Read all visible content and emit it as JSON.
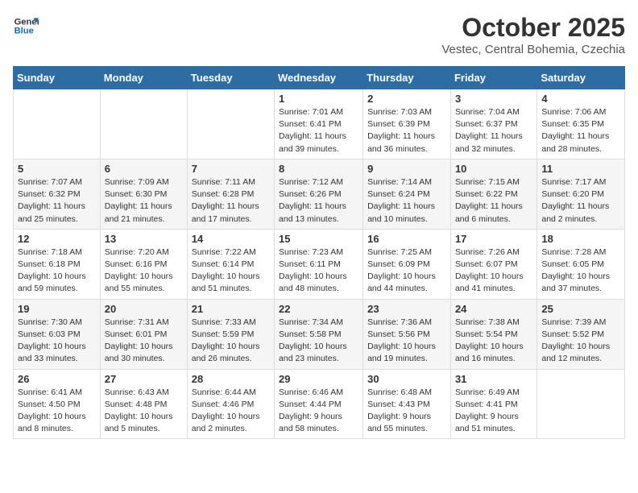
{
  "header": {
    "logo_line1": "General",
    "logo_line2": "Blue",
    "month": "October 2025",
    "location": "Vestec, Central Bohemia, Czechia"
  },
  "weekdays": [
    "Sunday",
    "Monday",
    "Tuesday",
    "Wednesday",
    "Thursday",
    "Friday",
    "Saturday"
  ],
  "weeks": [
    [
      {
        "day": "",
        "info": ""
      },
      {
        "day": "",
        "info": ""
      },
      {
        "day": "",
        "info": ""
      },
      {
        "day": "1",
        "info": "Sunrise: 7:01 AM\nSunset: 6:41 PM\nDaylight: 11 hours\nand 39 minutes."
      },
      {
        "day": "2",
        "info": "Sunrise: 7:03 AM\nSunset: 6:39 PM\nDaylight: 11 hours\nand 36 minutes."
      },
      {
        "day": "3",
        "info": "Sunrise: 7:04 AM\nSunset: 6:37 PM\nDaylight: 11 hours\nand 32 minutes."
      },
      {
        "day": "4",
        "info": "Sunrise: 7:06 AM\nSunset: 6:35 PM\nDaylight: 11 hours\nand 28 minutes."
      }
    ],
    [
      {
        "day": "5",
        "info": "Sunrise: 7:07 AM\nSunset: 6:32 PM\nDaylight: 11 hours\nand 25 minutes."
      },
      {
        "day": "6",
        "info": "Sunrise: 7:09 AM\nSunset: 6:30 PM\nDaylight: 11 hours\nand 21 minutes."
      },
      {
        "day": "7",
        "info": "Sunrise: 7:11 AM\nSunset: 6:28 PM\nDaylight: 11 hours\nand 17 minutes."
      },
      {
        "day": "8",
        "info": "Sunrise: 7:12 AM\nSunset: 6:26 PM\nDaylight: 11 hours\nand 13 minutes."
      },
      {
        "day": "9",
        "info": "Sunrise: 7:14 AM\nSunset: 6:24 PM\nDaylight: 11 hours\nand 10 minutes."
      },
      {
        "day": "10",
        "info": "Sunrise: 7:15 AM\nSunset: 6:22 PM\nDaylight: 11 hours\nand 6 minutes."
      },
      {
        "day": "11",
        "info": "Sunrise: 7:17 AM\nSunset: 6:20 PM\nDaylight: 11 hours\nand 2 minutes."
      }
    ],
    [
      {
        "day": "12",
        "info": "Sunrise: 7:18 AM\nSunset: 6:18 PM\nDaylight: 10 hours\nand 59 minutes."
      },
      {
        "day": "13",
        "info": "Sunrise: 7:20 AM\nSunset: 6:16 PM\nDaylight: 10 hours\nand 55 minutes."
      },
      {
        "day": "14",
        "info": "Sunrise: 7:22 AM\nSunset: 6:14 PM\nDaylight: 10 hours\nand 51 minutes."
      },
      {
        "day": "15",
        "info": "Sunrise: 7:23 AM\nSunset: 6:11 PM\nDaylight: 10 hours\nand 48 minutes."
      },
      {
        "day": "16",
        "info": "Sunrise: 7:25 AM\nSunset: 6:09 PM\nDaylight: 10 hours\nand 44 minutes."
      },
      {
        "day": "17",
        "info": "Sunrise: 7:26 AM\nSunset: 6:07 PM\nDaylight: 10 hours\nand 41 minutes."
      },
      {
        "day": "18",
        "info": "Sunrise: 7:28 AM\nSunset: 6:05 PM\nDaylight: 10 hours\nand 37 minutes."
      }
    ],
    [
      {
        "day": "19",
        "info": "Sunrise: 7:30 AM\nSunset: 6:03 PM\nDaylight: 10 hours\nand 33 minutes."
      },
      {
        "day": "20",
        "info": "Sunrise: 7:31 AM\nSunset: 6:01 PM\nDaylight: 10 hours\nand 30 minutes."
      },
      {
        "day": "21",
        "info": "Sunrise: 7:33 AM\nSunset: 5:59 PM\nDaylight: 10 hours\nand 26 minutes."
      },
      {
        "day": "22",
        "info": "Sunrise: 7:34 AM\nSunset: 5:58 PM\nDaylight: 10 hours\nand 23 minutes."
      },
      {
        "day": "23",
        "info": "Sunrise: 7:36 AM\nSunset: 5:56 PM\nDaylight: 10 hours\nand 19 minutes."
      },
      {
        "day": "24",
        "info": "Sunrise: 7:38 AM\nSunset: 5:54 PM\nDaylight: 10 hours\nand 16 minutes."
      },
      {
        "day": "25",
        "info": "Sunrise: 7:39 AM\nSunset: 5:52 PM\nDaylight: 10 hours\nand 12 minutes."
      }
    ],
    [
      {
        "day": "26",
        "info": "Sunrise: 6:41 AM\nSunset: 4:50 PM\nDaylight: 10 hours\nand 8 minutes."
      },
      {
        "day": "27",
        "info": "Sunrise: 6:43 AM\nSunset: 4:48 PM\nDaylight: 10 hours\nand 5 minutes."
      },
      {
        "day": "28",
        "info": "Sunrise: 6:44 AM\nSunset: 4:46 PM\nDaylight: 10 hours\nand 2 minutes."
      },
      {
        "day": "29",
        "info": "Sunrise: 6:46 AM\nSunset: 4:44 PM\nDaylight: 9 hours\nand 58 minutes."
      },
      {
        "day": "30",
        "info": "Sunrise: 6:48 AM\nSunset: 4:43 PM\nDaylight: 9 hours\nand 55 minutes."
      },
      {
        "day": "31",
        "info": "Sunrise: 6:49 AM\nSunset: 4:41 PM\nDaylight: 9 hours\nand 51 minutes."
      },
      {
        "day": "",
        "info": ""
      }
    ]
  ]
}
